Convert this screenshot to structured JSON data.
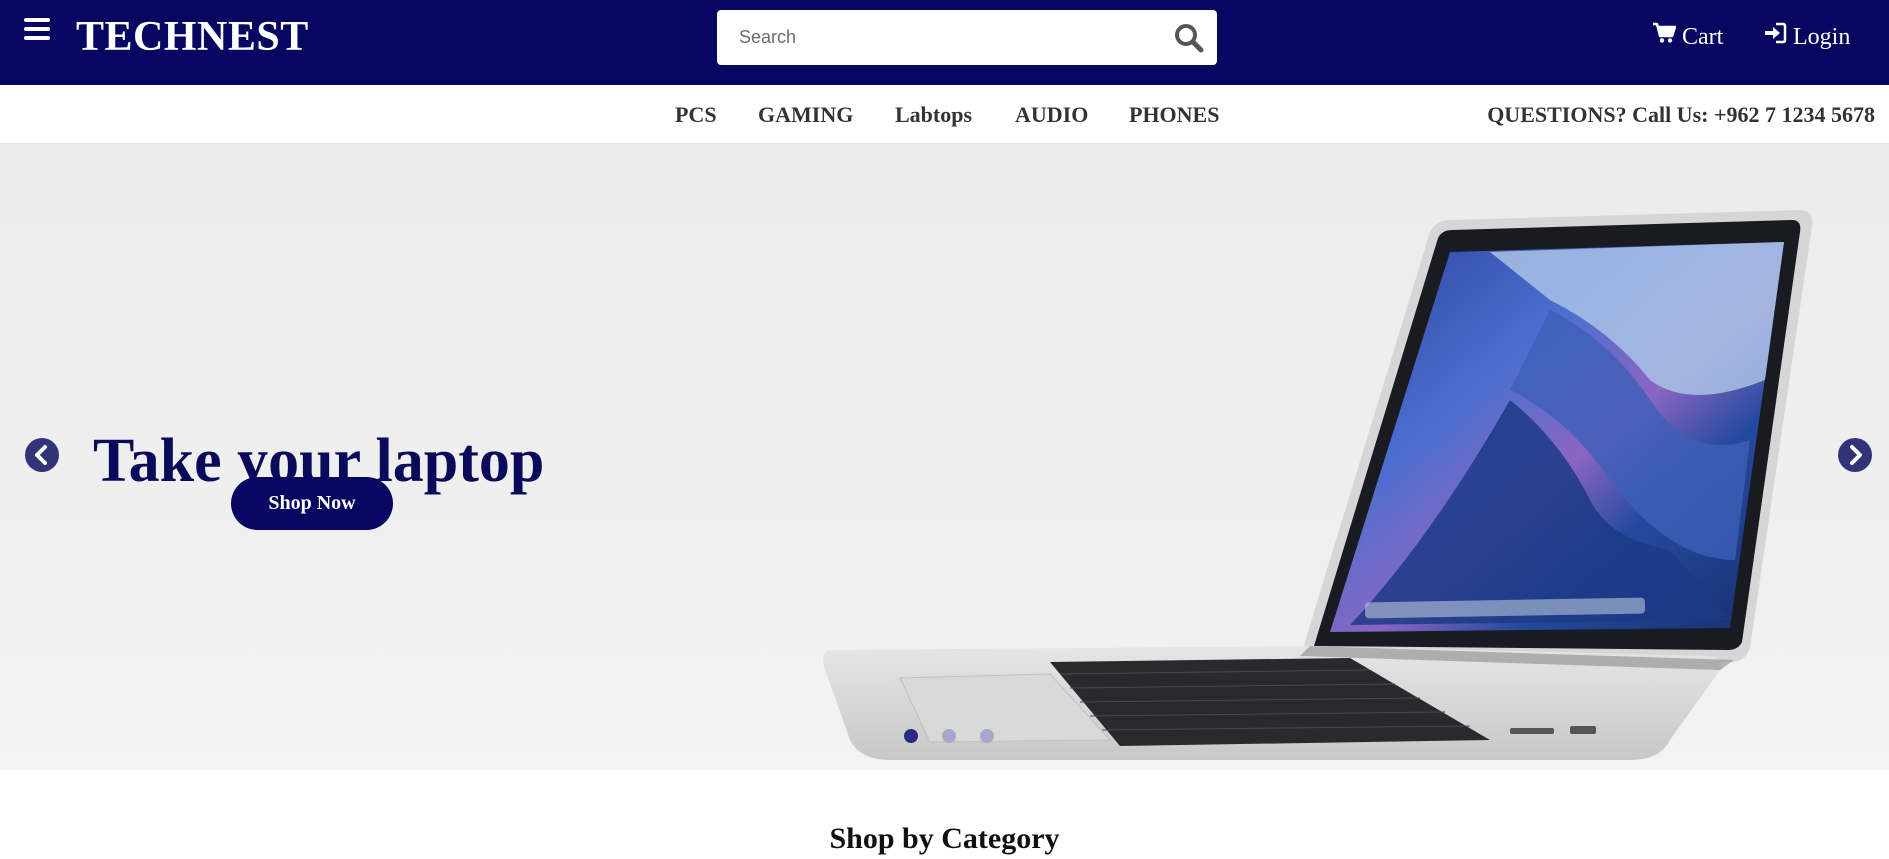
{
  "header": {
    "brand": "TECHNEST",
    "search_placeholder": "Search",
    "cart_label": "Cart",
    "login_label": "Login",
    "background_color": "#070661"
  },
  "nav": {
    "categories": [
      "PCS",
      "GAMING",
      "Labtops",
      "AUDIO",
      "PHONES"
    ],
    "contact_text": "QUESTIONS? Call Us: +962 7 1234 5678"
  },
  "hero": {
    "title": "Take your laptop",
    "cta_label": "Shop Now",
    "slide_count": 3,
    "active_slide": 1,
    "accent_color": "#070661"
  },
  "sections": {
    "shop_by_category": "Shop by Category"
  },
  "icons": {
    "menu": "hamburger-menu-icon",
    "search": "search-icon",
    "cart": "shopping-cart-icon",
    "login": "sign-in-icon",
    "prev": "chevron-left-circle-icon",
    "next": "chevron-right-circle-icon"
  }
}
